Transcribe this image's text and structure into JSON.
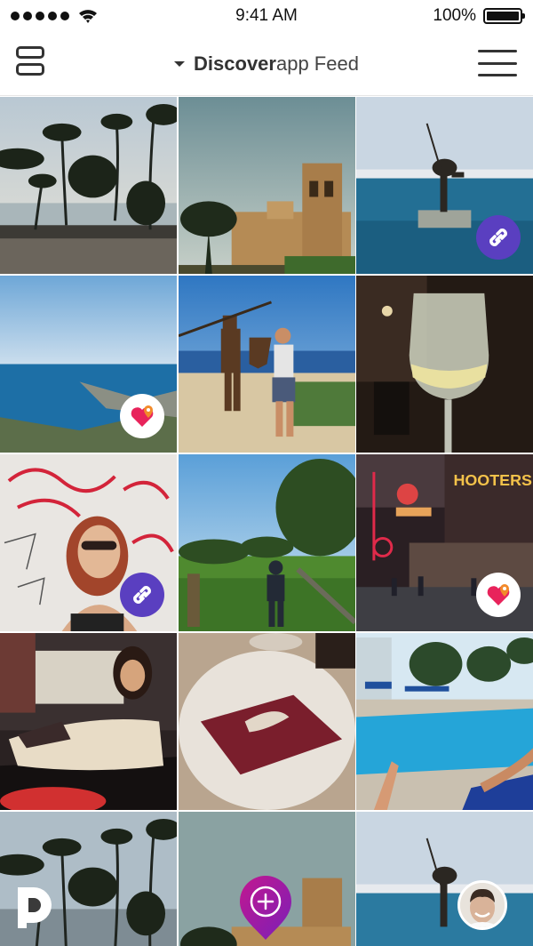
{
  "status_bar": {
    "time": "9:41 AM",
    "battery": "100%",
    "signal_icon": "signal-dots-icon",
    "wifi_icon": "wifi-icon",
    "battery_icon": "battery-icon"
  },
  "header": {
    "title_bold": "Discover",
    "title_rest": "app Feed",
    "left_icon": "layout-toggle-icon",
    "right_icon": "hamburger-menu-icon",
    "dropdown_icon": "caret-down-icon"
  },
  "colors": {
    "link_badge": "#5a3fc0",
    "fab_start": "#c2188f",
    "fab_end": "#7a1fb8",
    "heart": "#e8235b",
    "pin": "#f28a2a"
  },
  "feed": {
    "tiles": [
      {
        "scene": "palm-beach-sunset",
        "badge": null
      },
      {
        "scene": "church-with-palm",
        "badge": null
      },
      {
        "scene": "marina-statue",
        "badge": "link-icon"
      },
      {
        "scene": "coast-aerial",
        "badge": "heart-pin-icon"
      },
      {
        "scene": "knight-statue-man",
        "badge": null
      },
      {
        "scene": "wine-glass",
        "badge": null
      },
      {
        "scene": "graffiti-wall-woman",
        "badge": "link-icon"
      },
      {
        "scene": "green-field-man",
        "badge": null
      },
      {
        "scene": "hooters-neon-street",
        "badge": "heart-pin-icon"
      },
      {
        "scene": "woman-on-sofa",
        "badge": null
      },
      {
        "scene": "plate-dessert",
        "badge": null
      },
      {
        "scene": "resort-pool",
        "badge": null
      },
      {
        "scene": "palm-beach-sunset",
        "badge": null
      },
      {
        "scene": "church-with-palm",
        "badge": null
      },
      {
        "scene": "marina-statue",
        "badge": null
      }
    ],
    "sign_text": "HOOTERS"
  },
  "bottom": {
    "brand_logo_icon": "discover-d-logo-icon",
    "fab_icon": "add-pin-icon",
    "avatar": "profile-avatar"
  }
}
